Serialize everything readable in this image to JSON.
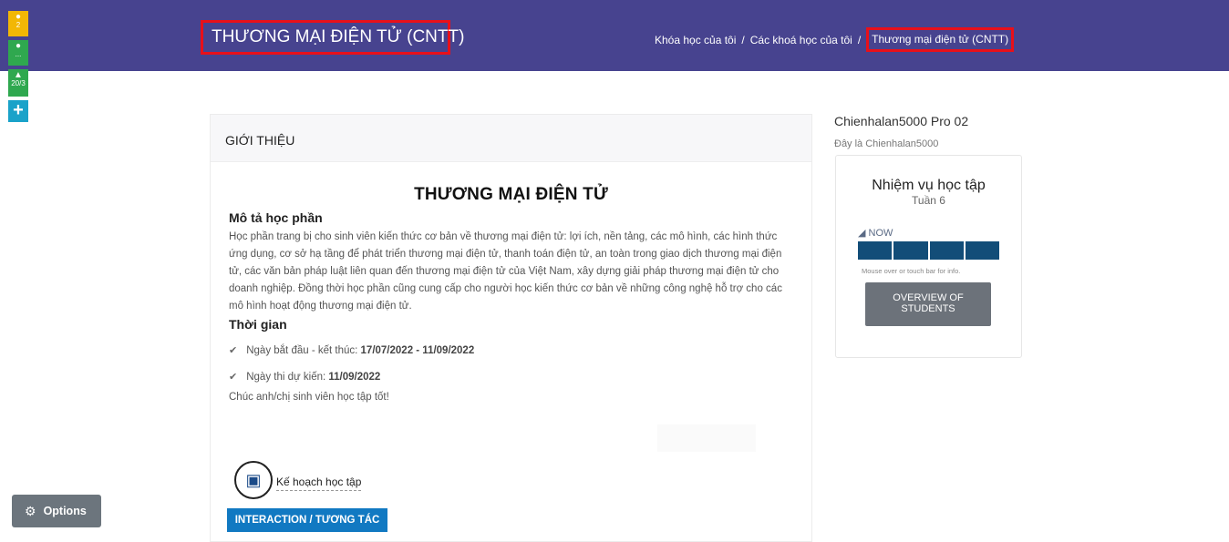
{
  "header": {
    "course_title": "THƯƠNG MẠI ĐIỆN TỬ (CNTT)",
    "breadcrumb": {
      "item1": "Khóa học của tôi",
      "item2": "Các khoá học của tôi",
      "current": "Thương mại điện tử (CNTT)",
      "separator": "/"
    }
  },
  "left_rail": {
    "notifications_count": "2",
    "messages_count": "...",
    "grades_value": "20/3",
    "icons": [
      "bell-icon",
      "chat-icon",
      "graduation-cap-icon",
      "plus-icon"
    ]
  },
  "intro_card": {
    "header": "GIỚI THIỆU",
    "title": "THƯƠNG MẠI ĐIỆN TỬ",
    "description_heading": "Mô tả học phần",
    "description": "Học phần trang bị cho sinh viên kiến thức cơ bản về thương mại điện tử: lợi ích, nền tảng, các mô hình, các hình thức ứng dụng, cơ sở hạ tầng để phát triển thương mại điện tử, thanh toán điện tử, an toàn trong giao dịch thương mại điện tử, các văn bản pháp luật liên quan đến thương mại điện tử của Việt Nam, xây dựng giải pháp thương mại điện tử cho doanh nghiệp. Đồng thời học phần cũng cung cấp cho người học kiến thức cơ bản về những công nghệ hỗ trợ cho các mô hình hoạt động thương mại điện tử.",
    "time_heading": "Thời gian",
    "start_end_label": "Ngày bắt đầu - kết thúc: ",
    "start_end_value": "17/07/2022 - 11/09/2022",
    "exam_label": "Ngày thi dự kiến: ",
    "exam_value": "11/09/2022",
    "greeting": "Chúc anh/chị sinh viên học tập tốt!",
    "plan_link": "Kế hoạch học tập",
    "interaction_button": "INTERACTION / TƯƠNG TÁC"
  },
  "sidebar": {
    "user_name": "Chienhalan5000 Pro 02",
    "user_subtitle": "Đây là Chienhalan5000",
    "tasks": {
      "title": "Nhiệm vụ học tập",
      "week": "Tuần 6",
      "now_label": "NOW",
      "progress_segments": 4,
      "hint": "Mouse over or touch bar for info.",
      "overview_button": "OVERVIEW OF STUDENTS"
    }
  },
  "options_button": "Options",
  "colors": {
    "header_bg": "#47438f",
    "highlight_border": "#e8101a",
    "interaction_bg": "#1179c2",
    "progress_bar": "#124d78",
    "options_bg": "#6c757d"
  }
}
